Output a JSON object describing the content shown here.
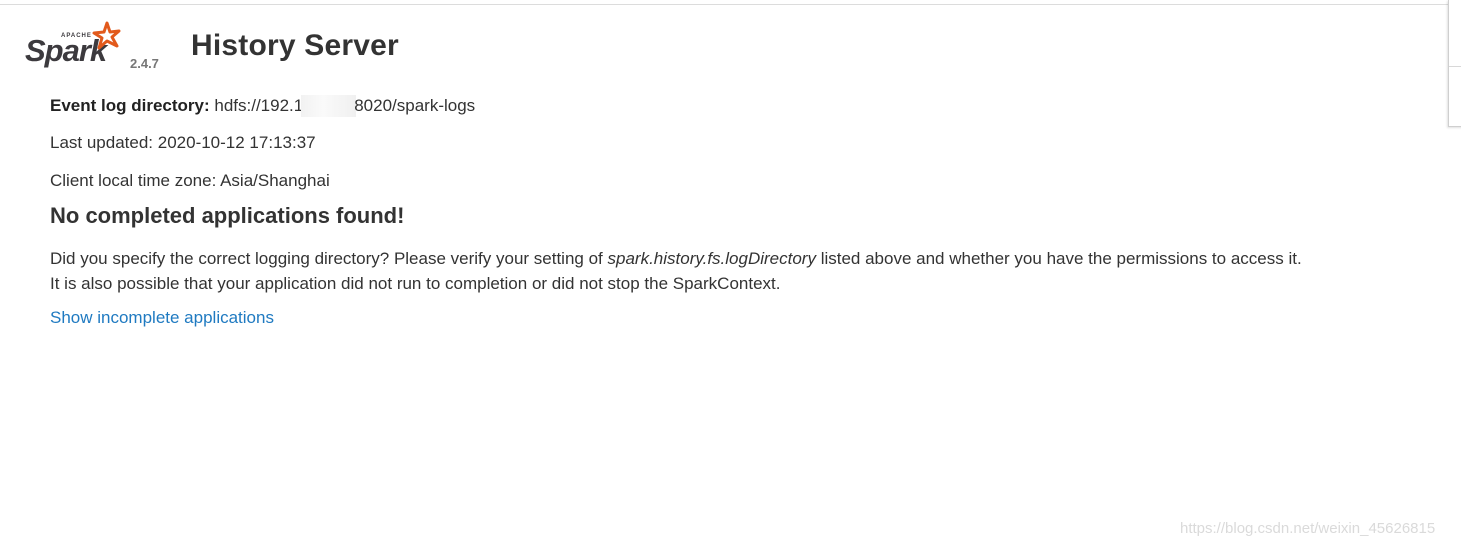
{
  "header": {
    "logo_text": "Spark",
    "logo_apache": "APACHE",
    "version": "2.4.7",
    "title": "History Server"
  },
  "info": {
    "event_log_label": "Event log directory:",
    "event_log_value_start": "hdfs://192.1",
    "event_log_value_end": "8020/spark-logs",
    "last_updated": "Last updated: 2020-10-12 17:13:37",
    "timezone": "Client local time zone: Asia/Shanghai"
  },
  "empty_state": {
    "heading": "No completed applications found!",
    "line1_before": "Did you specify the correct logging directory? Please verify your setting of ",
    "line1_code": "spark.history.fs.logDirectory",
    "line1_after": " listed above and whether you have the permissions to access it.",
    "line2": "It is also possible that your application did not run to completion or did not stop the SparkContext."
  },
  "link": {
    "incomplete_label": "Show incomplete applications"
  },
  "watermark": "https://blog.csdn.net/weixin_45626815",
  "colors": {
    "link": "#1f7ac1",
    "logo_star": "#e25a1c",
    "text": "#333333"
  }
}
